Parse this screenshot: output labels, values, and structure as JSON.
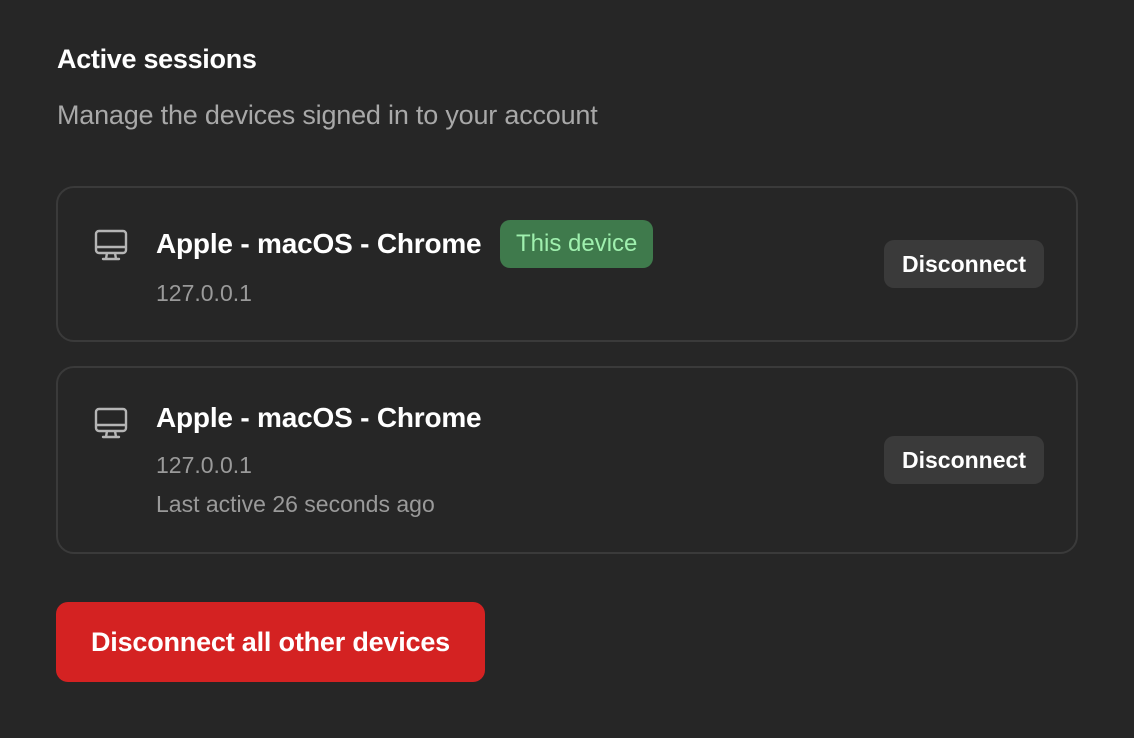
{
  "header": {
    "title": "Active sessions",
    "subtitle": "Manage the devices signed in to your account"
  },
  "sessions": [
    {
      "device_name": "Apple - macOS - Chrome",
      "badge": "This device",
      "ip": "127.0.0.1",
      "icon": "monitor-icon",
      "disconnect_label": "Disconnect"
    },
    {
      "device_name": "Apple - macOS - Chrome",
      "ip": "127.0.0.1",
      "last_active": "Last active 26 seconds ago",
      "icon": "monitor-icon",
      "disconnect_label": "Disconnect"
    }
  ],
  "actions": {
    "disconnect_all_label": "Disconnect all other devices"
  },
  "colors": {
    "background": "#262626",
    "badge_bg": "#3f7a4c",
    "badge_text": "#9ff0ae",
    "danger": "#d42222"
  }
}
